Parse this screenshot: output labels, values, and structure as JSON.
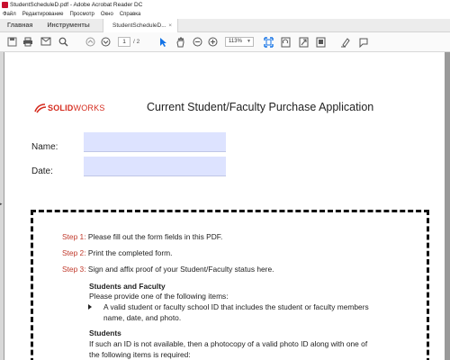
{
  "window": {
    "title": "StudentScheduleD.pdf - Adobe Acrobat Reader DC"
  },
  "menubar": {
    "items": [
      "Файл",
      "Редактирование",
      "Просмотр",
      "Окно",
      "Справка"
    ]
  },
  "tabs": {
    "home": "Главная",
    "tools": "Инструменты",
    "document": "StudentScheduleD...",
    "close": "×"
  },
  "toolbar": {
    "page_current": "1",
    "page_total": "/ 2",
    "zoom": "113%",
    "icons": [
      "save-icon",
      "print-icon",
      "email-icon",
      "search-icon",
      "page-up-icon",
      "page-down-icon",
      "select-cursor-icon",
      "hand-icon",
      "zoom-out-icon",
      "zoom-in-icon",
      "fit-page-icon",
      "rotate-icon",
      "fullscreen-icon",
      "scroll-mode-icon",
      "highlight-icon",
      "comment-icon"
    ]
  },
  "document": {
    "logo": {
      "brand_bold": "SOLID",
      "brand_rest": "WORKS"
    },
    "title": "Current Student/Faculty Purchase Application",
    "name_label": "Name:",
    "date_label": "Date:",
    "name_value": "",
    "date_value": "",
    "steps": [
      {
        "num": "Step 1:",
        "text": " Please fill out the form fields in this PDF."
      },
      {
        "num": "Step 2:",
        "text": " Print the completed form."
      },
      {
        "num": "Step 3:",
        "text": " Sign and affix proof of your Student/Faculty status here."
      }
    ],
    "section1": {
      "heading": "Students and Faculty",
      "intro": "Please provide one of the following items:",
      "bullet_line1": "A valid student or faculty school ID that includes the student or faculty members",
      "bullet_line2": "name, date, and photo."
    },
    "section2": {
      "heading": "Students",
      "line1": "If such an ID is not available, then a photocopy of a valid photo ID along with one of",
      "line2": "the following items is required:"
    }
  },
  "colors": {
    "accent_red": "#c0392b",
    "logo_red": "#d52b1e",
    "field_fill": "#dde3ff",
    "tool_blue": "#1473e6"
  }
}
